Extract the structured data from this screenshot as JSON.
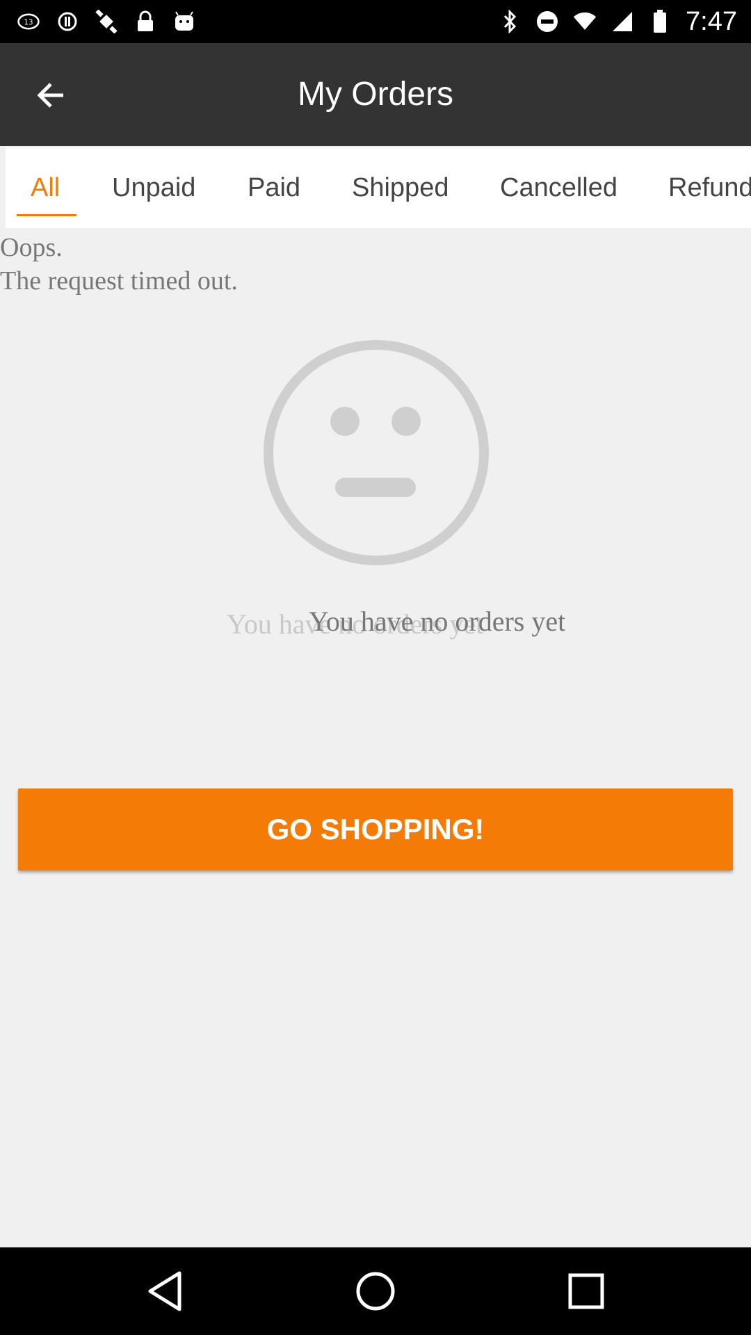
{
  "status_bar": {
    "time": "7:47",
    "left_icons": [
      "abc13-icon",
      "fake-gps-icon",
      "satellite-icon",
      "lock-icon",
      "android-icon"
    ],
    "right_icons": [
      "bluetooth-icon",
      "do-not-disturb-icon",
      "wifi-icon",
      "signal-icon",
      "battery-icon"
    ]
  },
  "app_bar": {
    "title": "My Orders",
    "back_icon": "arrow-left-icon"
  },
  "tabs": [
    {
      "label": "All",
      "active": true
    },
    {
      "label": "Unpaid",
      "active": false
    },
    {
      "label": "Paid",
      "active": false
    },
    {
      "label": "Shipped",
      "active": false
    },
    {
      "label": "Cancelled",
      "active": false
    },
    {
      "label": "Refund",
      "active": false
    }
  ],
  "content": {
    "error_line1": "Oops.",
    "error_line2": "The request timed out.",
    "empty_icon": "neutral-face-icon",
    "empty_message": "You have no orders yet",
    "empty_message_ghost": "You have no orders yet",
    "cta_label": "GO SHOPPING!"
  },
  "colors": {
    "accent": "#f47c06",
    "app_bar": "#333333",
    "background": "#f0f0f0"
  },
  "nav_bar": {
    "buttons": [
      "back-triangle-icon",
      "home-circle-icon",
      "recents-square-icon"
    ]
  }
}
